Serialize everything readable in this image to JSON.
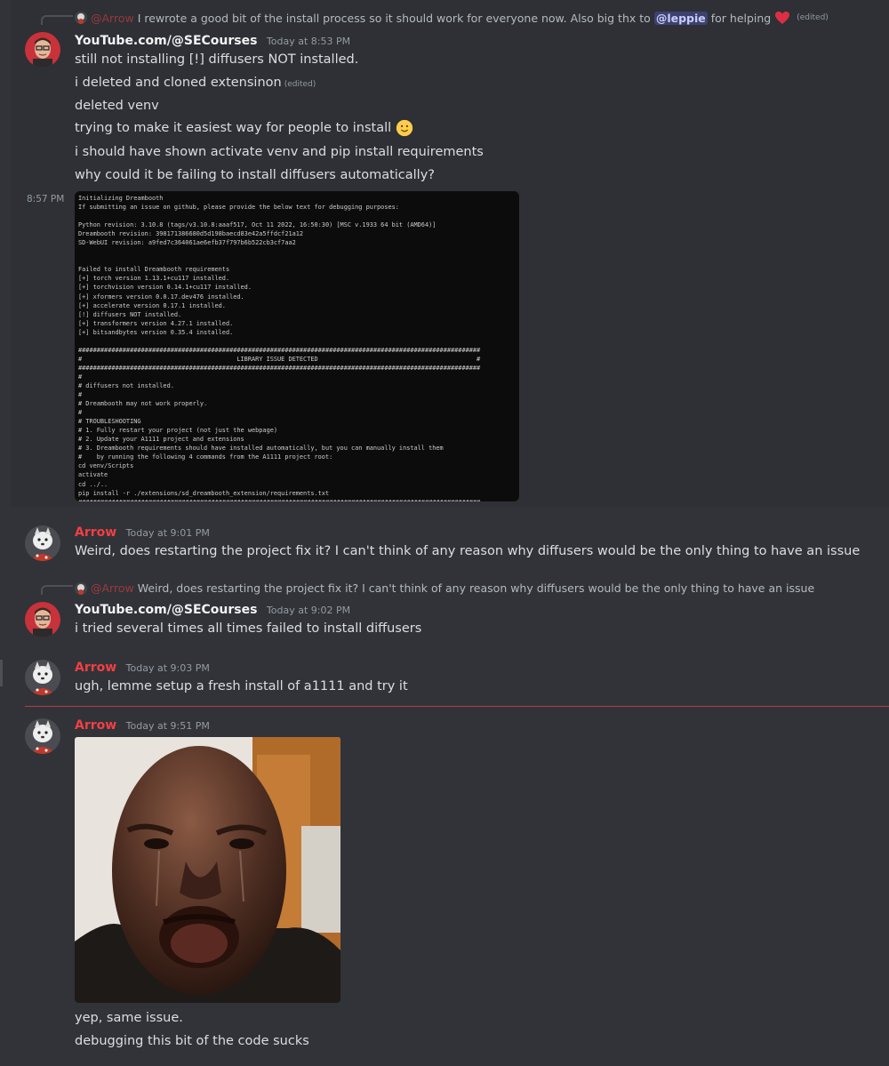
{
  "colors": {
    "background": "#313338",
    "arrow_name": "#f23f43",
    "mention_bg": "#3c4270"
  },
  "messages": {
    "m1": {
      "reply": {
        "author": "@Arrow",
        "text_before": "I rewrote a good bit of the install process so it should work for everyone now. Also big thx to",
        "mention": "@leppie",
        "text_after": "for helping",
        "emoji": "heart-icon",
        "edited": "(edited)"
      },
      "author": "YouTube.com/@SECourses",
      "timestamp": "Today at 8:53 PM",
      "lines": [
        "still not installing [!] diffusers NOT installed.",
        "i deleted and cloned extensinon",
        "deleted venv",
        "trying to make it easiest way for people to install",
        "i should have shown activate venv and pip install requirements",
        "why could it be failing to install diffusers automatically?"
      ],
      "line2_edited": "(edited)",
      "line4_emoji": "slightly-smiling-face-icon"
    },
    "m1_followup": {
      "timestamp": "8:57 PM",
      "terminal_text": "Initializing Dreambooth\nIf submitting an issue on github, please provide the below text for debugging purposes:\n\nPython revision: 3.10.8 (tags/v3.10.8:aaaf517, Oct 11 2022, 16:50:30) [MSC v.1933 64 bit (AMD64)]\nDreambooth revision: 398171386680d5d198baecd83e42a5ffdcf21a12\nSD-WebUI revision: a9fed7c364061ae6efb37f797b6b522cb3cf7aa2\n\n\nFailed to install Dreambooth requirements\n[+] torch version 1.13.1+cu117 installed.\n[+] torchvision version 0.14.1+cu117 installed.\n[+] xformers version 0.0.17.dev476 installed.\n[+] accelerate version 0.17.1 installed.\n[!] diffusers NOT installed.\n[+] transformers version 4.27.1 installed.\n[+] bitsandbytes version 0.35.4 installed.\n\n#############################################################################################################\n#                                          LIBRARY ISSUE DETECTED                                           #\n#############################################################################################################\n#\n# diffusers not installed.\n#\n# Dreambooth may not work properly.\n#\n# TROUBLESHOOTING\n# 1. Fully restart your project (not just the webpage)\n# 2. Update your A1111 project and extensions\n# 3. Dreambooth requirements should have installed automatically, but you can manually install them\n#    by running the following 4 commands from the A1111 project root:\ncd venv/Scripts\nactivate\ncd ../..\npip install -r ./extensions/sd_dreambooth_extension/requirements.txt\n#############################################################################################################"
    },
    "m2": {
      "author": "Arrow",
      "timestamp": "Today at 9:01 PM",
      "text": "Weird, does restarting the project fix it? I can't think of any reason why diffusers would be the only thing to have an issue"
    },
    "m3": {
      "reply": {
        "author": "@Arrow",
        "text": "Weird, does restarting the project fix it? I can't think of any reason why diffusers would be the only thing to have an issue"
      },
      "author": "YouTube.com/@SECourses",
      "timestamp": "Today at 9:02 PM",
      "text": "i tried several times all times failed to install diffusers"
    },
    "m4": {
      "author": "Arrow",
      "timestamp": "Today at 9:03 PM",
      "text": "ugh, lemme setup a fresh install of a1111 and try it"
    },
    "m5": {
      "author": "Arrow",
      "timestamp": "Today at 9:51 PM",
      "lines": [
        "yep, same issue.",
        "debugging this bit of the code sucks"
      ]
    }
  }
}
